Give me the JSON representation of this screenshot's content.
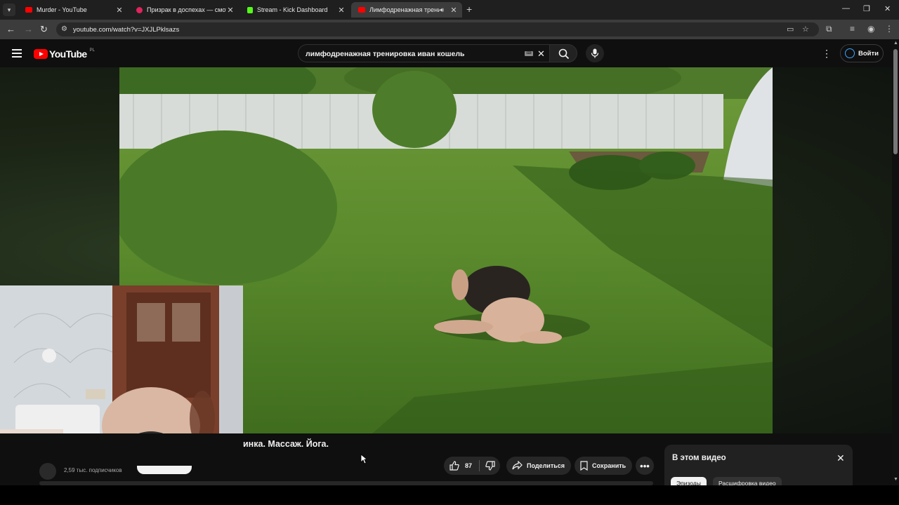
{
  "browser": {
    "tabs": [
      {
        "title": "Murder - YouTube",
        "favicon_color": "#ff0000",
        "active": false
      },
      {
        "title": "Призрак в доспехах — смотреть",
        "favicon_color": "#e0245e",
        "active": false
      },
      {
        "title": "Stream - Kick Dashboard",
        "favicon_color": "#53fc18",
        "active": false
      },
      {
        "title": "Лимфодренажная трениро",
        "favicon_color": "#ff0000",
        "active": true
      }
    ],
    "url": "youtube.com/watch?v=JXJLPklsazs"
  },
  "youtube": {
    "logo_text": "YouTube",
    "country_code": "PL",
    "search_query": "лимфодренажная тренировка иван кошель",
    "signin_label": "Войти"
  },
  "video": {
    "title_visible": "инка. Массаж. Йога.",
    "subscribers": "2,59 тыс. подписчиков",
    "likes": "87",
    "share_label": "Поделиться",
    "save_label": "Сохранить"
  },
  "side_panel": {
    "title": "В этом видео",
    "chips": [
      "Эпизоды",
      "Расшифровка видео"
    ]
  },
  "colors": {
    "accent_blue": "#3ea6ff",
    "youtube_red": "#ff0000",
    "background": "#0f0f0f"
  }
}
